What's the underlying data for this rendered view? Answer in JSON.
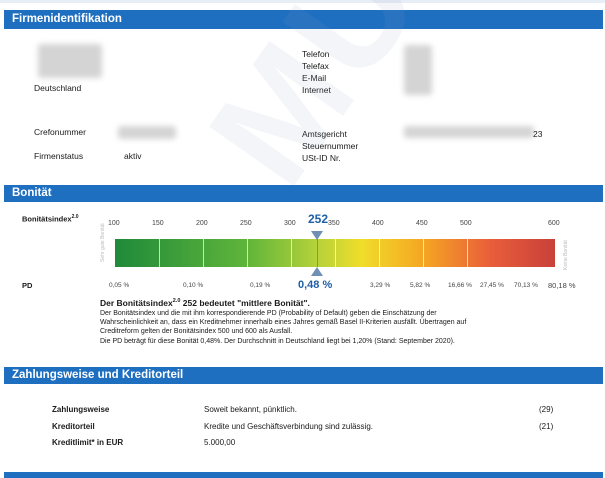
{
  "sections": {
    "firm": {
      "title": "Firmenidentifikation"
    },
    "rating": {
      "title": "Bonität"
    },
    "payment": {
      "title": "Zahlungsweise und Kreditorteil"
    }
  },
  "firm": {
    "country": "Deutschland",
    "right_labels": [
      "Telefon",
      "Telefax",
      "E-Mail",
      "Internet"
    ],
    "crefo_label": "Crefonummer",
    "status_label": "Firmenstatus",
    "status_value": "aktiv",
    "court_label": "Amtsgericht",
    "tax_label": "Steuernummer",
    "vat_label": "USt-ID Nr.",
    "court_value_partial": "23"
  },
  "rating": {
    "index_label": "Bonitätsindex",
    "index_label_sup": "2.0",
    "score": "252",
    "pd_at_score": "0,48 %",
    "scale_ticks": [
      {
        "value": 100,
        "label": "100"
      },
      {
        "value": 150,
        "label": "150"
      },
      {
        "value": 200,
        "label": "200"
      },
      {
        "value": 250,
        "label": "250"
      },
      {
        "value": 300,
        "label": "300"
      },
      {
        "value": 350,
        "label": "350"
      },
      {
        "value": 400,
        "label": "400"
      },
      {
        "value": 450,
        "label": "450"
      },
      {
        "value": 500,
        "label": "500"
      },
      {
        "value": 600,
        "label": "600"
      }
    ],
    "pd_label": "PD",
    "pd_values": [
      "0,05 %",
      "0,10 %",
      "0,19 %",
      "3,29 %",
      "5,82 %",
      "16,66 %",
      "27,45 %",
      "70,13 %",
      "80,18 %"
    ],
    "rail_left": "Sehr gute Bonität",
    "rail_right": "Keine Bonität",
    "desc_title_a": "Der Bonitätsindex",
    "desc_title_sup": "2.0",
    "desc_title_b": "252 bedeutet \"mittlere Bonität\".",
    "desc_lines": [
      "Der Bonitätsindex und die mit ihm korrespondierende PD (Probability of Default) geben die Einschätzung der",
      "Wahrscheinlichkeit an, dass ein Kreditnehmer innerhalb eines Jahres gemäß Basel II-Kriterien ausfällt. Übertragen auf",
      "Creditreform gelten der Bonitätsindex 500 und 600 als Ausfall.",
      "Die PD beträgt für diese Bonität 0,48%. Der Durchschnitt in Deutschland liegt bei 1,20% (Stand: September 2020)."
    ]
  },
  "payment": {
    "rows": [
      {
        "label": "Zahlungsweise",
        "value": "Soweit bekannt, pünktlich.",
        "code": "(29)"
      },
      {
        "label": "Kreditorteil",
        "value": "Kredite und Geschäftsverbindung sind zulässig.",
        "code": "(21)"
      },
      {
        "label": "Kreditlimit* in EUR",
        "value": "5.000,00",
        "code": ""
      }
    ]
  },
  "watermark": "MUSTER"
}
